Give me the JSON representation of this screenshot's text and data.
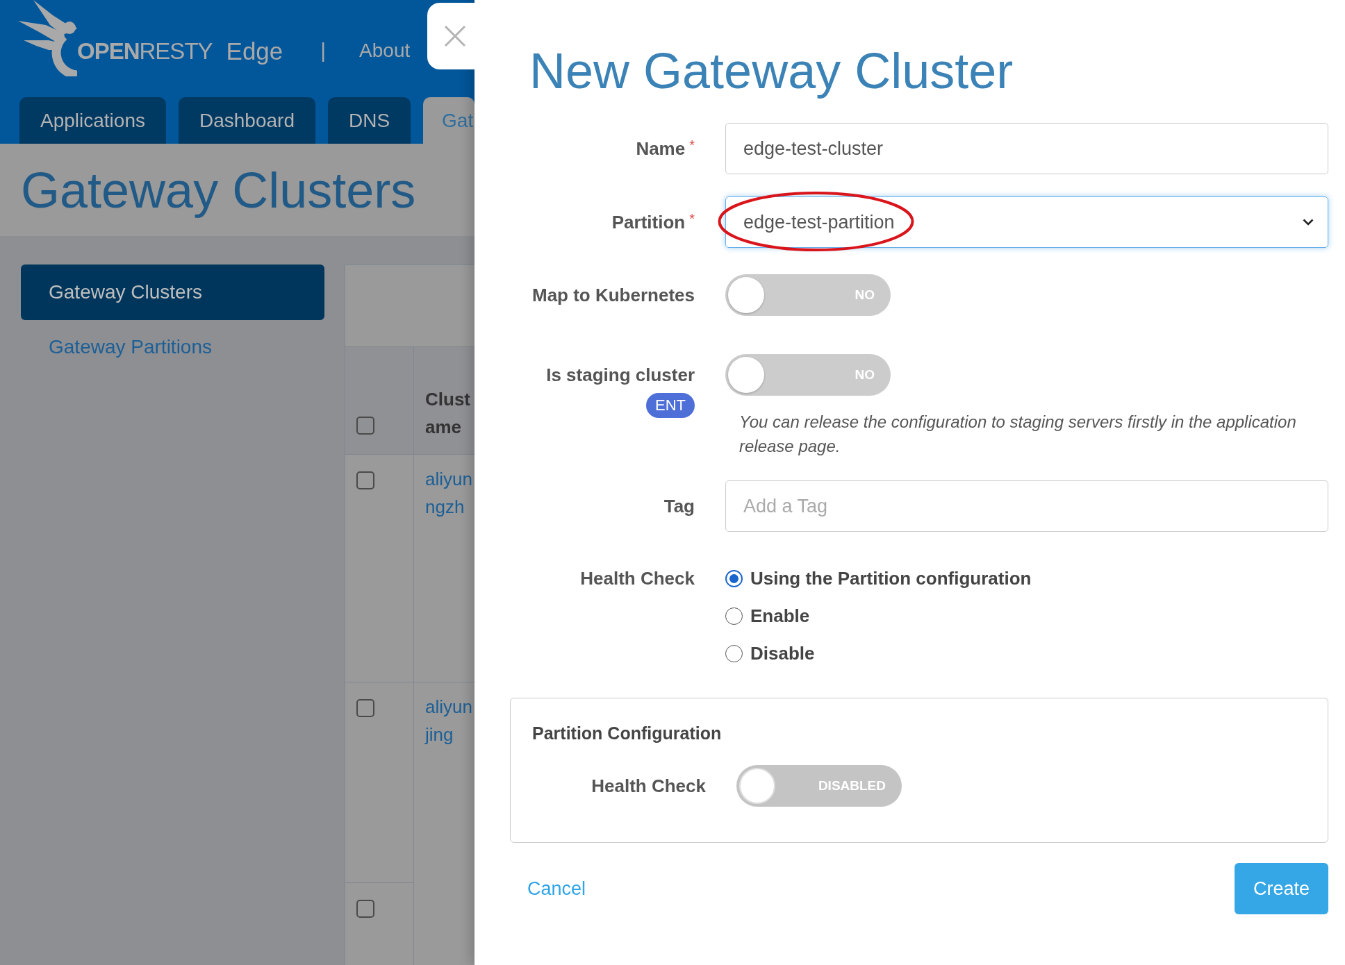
{
  "app_header": {
    "logo_text": "**OPEN**RESTY",
    "product": "Edge",
    "separator": "|",
    "links": [
      {
        "label": "About"
      }
    ]
  },
  "main_tabs": [
    {
      "label": "Applications",
      "selected": false
    },
    {
      "label": "Dashboard",
      "selected": false
    },
    {
      "label": "DNS",
      "selected": false
    },
    {
      "label": "Gat",
      "selected": true
    }
  ],
  "page_title": "Gateway Clusters",
  "sidebar": {
    "items": [
      {
        "label": "Gateway Clusters",
        "selected": true
      },
      {
        "label": "Gateway Partitions",
        "selected": false
      }
    ]
  },
  "table": {
    "header": {
      "checked": false,
      "column_2": [
        "Clust",
        "ame"
      ]
    },
    "rows": [
      {
        "checked": false,
        "column_2": [
          "aliyun",
          "ngzh"
        ]
      },
      {
        "checked": false,
        "column_2": [
          "aliyun",
          "jing"
        ]
      },
      {
        "checked": false
      }
    ]
  },
  "dialog": {
    "title": "New Gateway Cluster",
    "fields": [
      {
        "kind": "text",
        "label": "Name",
        "required_mark": "*",
        "value": "edge-test-cluster",
        "focused": false
      },
      {
        "kind": "select",
        "label": "Partition",
        "required_mark": "*",
        "value": "edge-test-partition",
        "focused": true,
        "circled": true
      },
      {
        "kind": "toggle",
        "label": "Map to Kubernetes",
        "on": false,
        "disabled": false,
        "state_label": "NO"
      },
      {
        "kind": "toggle",
        "label": "Is staging cluster",
        "badge": "ENT",
        "on": false,
        "disabled": false,
        "state_label": "NO",
        "help": "You can release the configuration to staging servers firstly in the application release page."
      },
      {
        "kind": "text",
        "label": "Tag",
        "placeholder": "Add a Tag",
        "focused": false
      },
      {
        "kind": "radio",
        "label": "Health Check",
        "options": [
          {
            "label": "Using the Partition configuration",
            "selected": true
          },
          {
            "label": "Enable",
            "selected": false
          },
          {
            "label": "Disable",
            "selected": false
          }
        ]
      }
    ],
    "partition_configuration": {
      "title": "Partition Configuration",
      "fields": [
        {
          "kind": "toggle",
          "label": "Health Check",
          "on": false,
          "disabled": true,
          "state_label": "DISABLED"
        }
      ]
    },
    "actions": [
      {
        "kind": "link",
        "label": "Cancel"
      },
      {
        "kind": "primary",
        "label": "Create"
      }
    ]
  }
}
